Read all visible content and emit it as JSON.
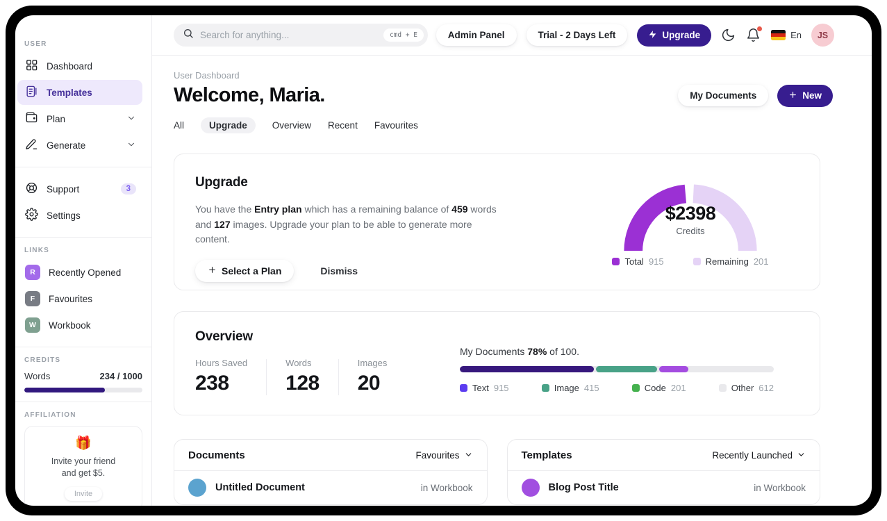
{
  "topbar": {
    "search_placeholder": "Search for anything...",
    "search_shortcut": "cmd + E",
    "admin_panel_label": "Admin Panel",
    "trial_label": "Trial - 2 Days Left",
    "upgrade_label": "Upgrade",
    "language_label": "En",
    "avatar_initials": "JS",
    "accent_color": "#371d8f"
  },
  "sidebar": {
    "user_section_label": "USER",
    "nav_items": [
      {
        "label": "Dashboard",
        "icon": "dashboard-grid-icon"
      },
      {
        "label": "Templates",
        "icon": "templates-icon",
        "active": true
      },
      {
        "label": "Plan",
        "icon": "wallet-icon",
        "has_chevron": true
      },
      {
        "label": "Generate",
        "icon": "pencil-icon",
        "has_chevron": true
      },
      {
        "label": "Support",
        "icon": "lifebuoy-icon",
        "badge": "3"
      },
      {
        "label": "Settings",
        "icon": "gear-icon"
      }
    ],
    "links_section_label": "LINKS",
    "link_items": [
      {
        "label": "Recently Opened",
        "initial": "R",
        "color": "#a36bea"
      },
      {
        "label": "Favourites",
        "initial": "F",
        "color": "#787c84"
      },
      {
        "label": "Workbook",
        "initial": "W",
        "color": "#7fa090"
      }
    ],
    "credits_section_label": "CREDITS",
    "credits": {
      "label": "Words",
      "value": "234 / 1000",
      "percent_filled": "68%",
      "bar_color": "#31187e"
    },
    "affiliation_section_label": "AFFILIATION",
    "affiliation": {
      "emoji": "🎁",
      "line1": "Invite your friend",
      "line2": "and get $5.",
      "button_label": "Invite"
    }
  },
  "header": {
    "breadcrumb": "User Dashboard",
    "title": "Welcome, Maria.",
    "my_documents_label": "My Documents",
    "new_label": "New",
    "tabs": [
      {
        "label": "All"
      },
      {
        "label": "Upgrade",
        "active": true
      },
      {
        "label": "Overview"
      },
      {
        "label": "Recent"
      },
      {
        "label": "Favourites"
      }
    ]
  },
  "upgrade_card": {
    "title": "Upgrade",
    "body": {
      "p1": "You have the ",
      "b1": "Entry plan",
      "p2": " which has a remaining balance of ",
      "b2": "459",
      "p3": " words and ",
      "b3": "127",
      "p4": " images. Upgrade your plan to be able to generate more content."
    },
    "select_plan_label": "Select a Plan",
    "dismiss_label": "Dismiss",
    "gauge_center_value": "$2398",
    "gauge_center_caption": "Credits"
  },
  "overview_card": {
    "title": "Overview",
    "stats": [
      {
        "label": "Hours Saved",
        "value": "238"
      },
      {
        "label": "Words",
        "value": "128"
      },
      {
        "label": "Images",
        "value": "20"
      }
    ],
    "docs_progress": {
      "prefix": "My Documents ",
      "percent": "78%",
      "suffix": " of 100."
    }
  },
  "documents_card": {
    "title": "Documents",
    "filter_label": "Favourites",
    "items": [
      {
        "name": "Untitled Document",
        "location": "in Workbook",
        "avatar_color": "#5ba3cf"
      }
    ]
  },
  "templates_card": {
    "title": "Templates",
    "filter_label": "Recently Launched",
    "items": [
      {
        "name": "Blog Post Title",
        "location": "in Workbook",
        "avatar_color": "#a14fe0"
      }
    ]
  },
  "chart_data": [
    {
      "type": "pie",
      "variant": "semicircle-gauge",
      "title": "Credits",
      "center_value": "$2398",
      "series": [
        {
          "name": "Total",
          "value": 915,
          "color": "#9b30d4"
        },
        {
          "name": "Remaining",
          "value": 201,
          "color": "#e5d3f6"
        }
      ],
      "legend_position": "bottom"
    },
    {
      "type": "bar",
      "variant": "stacked-horizontal-progress",
      "title": "My Documents 78% of 100.",
      "series": [
        {
          "name": "Text",
          "value": 915,
          "color": "#37187d",
          "legend_color": "#5b3cf0"
        },
        {
          "name": "Image",
          "value": 415,
          "color": "#48a287",
          "legend_color": "#48a287"
        },
        {
          "name": "Code",
          "value": 201,
          "color": "#a44ce0",
          "legend_color": "#45b14e"
        },
        {
          "name": "Other",
          "value": 612,
          "color": "#e9e9ec",
          "legend_color": "#e9e9ec",
          "is_track": true
        }
      ]
    }
  ]
}
